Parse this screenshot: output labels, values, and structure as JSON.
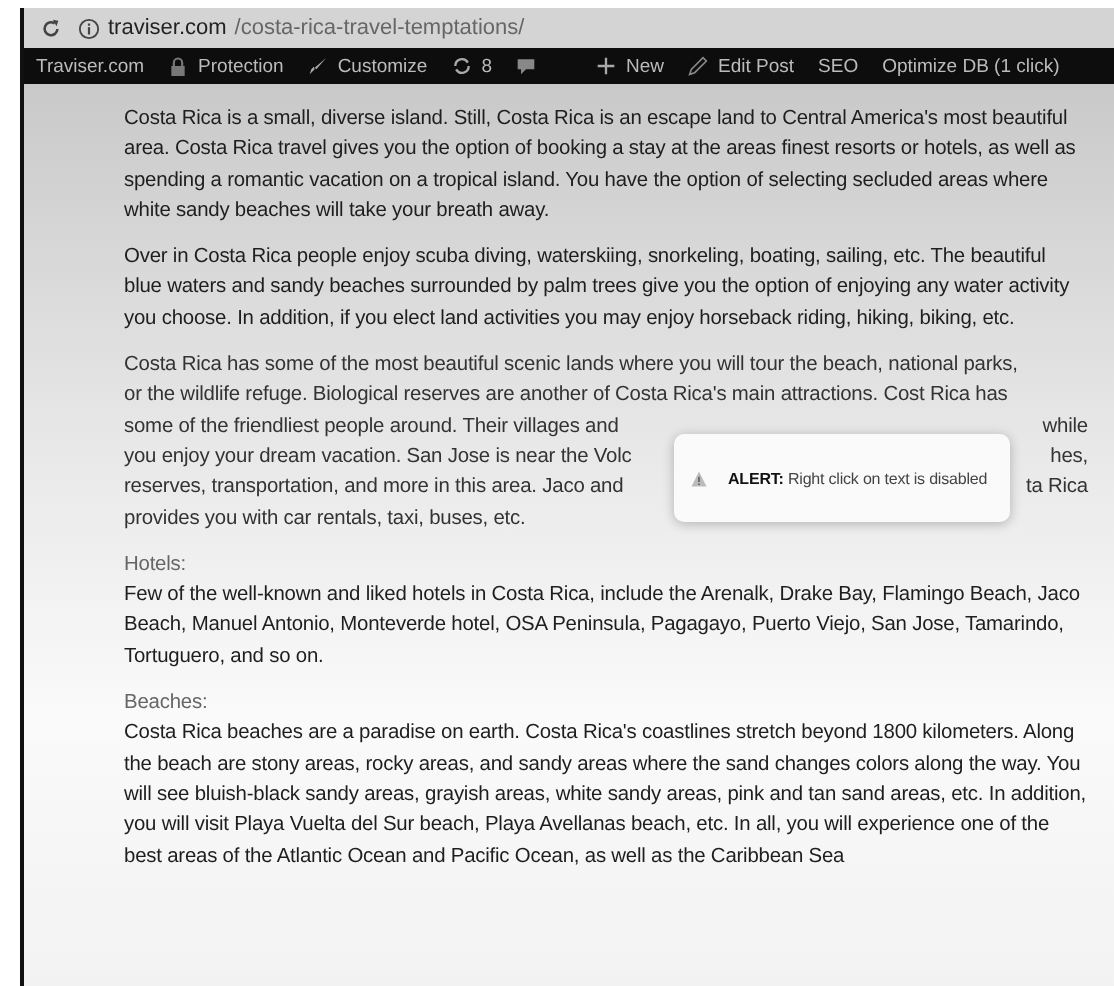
{
  "browser": {
    "url_host": "traviser.com",
    "url_path": "/costa-rica-travel-temptations/"
  },
  "admin_bar": [
    {
      "kind": "site",
      "label": "Traviser.com"
    },
    {
      "kind": "lock",
      "label": "Protection"
    },
    {
      "kind": "brush",
      "label": "Customize"
    },
    {
      "kind": "updates",
      "label": "8"
    },
    {
      "kind": "comments"
    },
    {
      "kind": "new",
      "label": "New"
    },
    {
      "kind": "edit",
      "label": "Edit Post"
    },
    {
      "kind": "text",
      "label": "SEO"
    },
    {
      "kind": "text",
      "label": "Optimize DB (1 click)"
    }
  ],
  "content": [
    {
      "kind": "paragraph",
      "text": "Costa Rica is a small, diverse island. Still, Costa Rica is an escape land to Central America's most beautiful area. Costa Rica travel gives you the option of booking a stay at the areas finest resorts or hotels, as well as spending a romantic vacation on a tropical island. You have the option of selecting secluded areas where white sandy beaches will take your breath away."
    },
    {
      "kind": "paragraph",
      "text": "Over in Costa Rica people enjoy scuba diving, waterskiing, snorkeling, boating, sailing, etc. The beautiful blue waters and sandy beaches surrounded by palm trees give you the option of enjoying any water activity you choose. In addition, if you elect land activities you may enjoy horseback riding, hiking, biking, etc."
    },
    {
      "kind": "covered",
      "lines": [
        {
          "left": "Costa Rica has some of the most beautiful scenic lands where you will tour the beach, national parks,"
        },
        {
          "left": "or the wildlife refuge. Biological reserves are another of Costa Rica's main attractions. Cost Rica has"
        },
        {
          "left": "some of the friendliest people around. Their villages and",
          "right": "while"
        },
        {
          "left": "you enjoy your dream vacation. San Jose is near the Volc",
          "right": "hes,"
        },
        {
          "left": "reserves, transportation, and more in this area. Jaco and",
          "right": "ta Rica"
        },
        {
          "left": "provides you with car rentals, taxi, buses, etc."
        }
      ]
    },
    {
      "kind": "heading",
      "text": "Hotels:"
    },
    {
      "kind": "paragraph",
      "text": "Few of the well-known and liked hotels in Costa Rica, include the Arenalk, Drake Bay, Flamingo Beach, Jaco Beach, Manuel Antonio, Monteverde hotel, OSA Peninsula, Pagagayo, Puerto Viejo, San Jose, Tamarindo, Tortuguero, and so on."
    },
    {
      "kind": "heading",
      "text": "Beaches:"
    },
    {
      "kind": "paragraph",
      "text": "Costa Rica beaches are a paradise on earth. Costa Rica's coastlines stretch beyond 1800 kilometers. Along the beach are stony areas, rocky areas, and sandy areas where the sand changes colors along the way. You will see bluish-black sandy areas, grayish areas, white sandy areas, pink and tan sand areas, etc. In addition, you will visit Playa Vuelta del Sur beach, Playa Avellanas beach, etc. In all, you will experience one of the best areas of the Atlantic Ocean and Pacific Ocean, as well as the Caribbean Sea"
    }
  ],
  "alert": {
    "text": "**ALERT:** Right click on text is disabled"
  }
}
